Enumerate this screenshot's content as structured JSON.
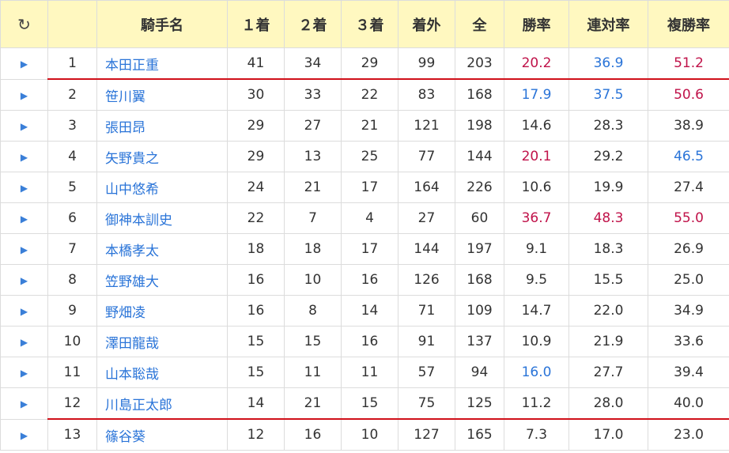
{
  "header": {
    "refresh_icon": "refresh-icon",
    "columns": [
      "騎手名",
      "１着",
      "２着",
      "３着",
      "着外",
      "全",
      "勝率",
      "連対率",
      "複勝率"
    ]
  },
  "colors": {
    "high": "#c0134a",
    "mid": "#2a74d8",
    "separator": "#d0101a",
    "header_bg": "#fff8c0"
  },
  "rows": [
    {
      "rank": "1",
      "name": "本田正重",
      "w1": "41",
      "w2": "34",
      "w3": "29",
      "out": "99",
      "total": "203",
      "win": "20.2",
      "win_c": "red",
      "ren": "36.9",
      "ren_c": "blue",
      "fuku": "51.2",
      "fuku_c": "red",
      "sep": true
    },
    {
      "rank": "2",
      "name": "笹川翼",
      "w1": "30",
      "w2": "33",
      "w3": "22",
      "out": "83",
      "total": "168",
      "win": "17.9",
      "win_c": "blue",
      "ren": "37.5",
      "ren_c": "blue",
      "fuku": "50.6",
      "fuku_c": "red",
      "sep": false
    },
    {
      "rank": "3",
      "name": "張田昂",
      "w1": "29",
      "w2": "27",
      "w3": "21",
      "out": "121",
      "total": "198",
      "win": "14.6",
      "win_c": "",
      "ren": "28.3",
      "ren_c": "",
      "fuku": "38.9",
      "fuku_c": "",
      "sep": false
    },
    {
      "rank": "4",
      "name": "矢野貴之",
      "w1": "29",
      "w2": "13",
      "w3": "25",
      "out": "77",
      "total": "144",
      "win": "20.1",
      "win_c": "red",
      "ren": "29.2",
      "ren_c": "",
      "fuku": "46.5",
      "fuku_c": "blue",
      "sep": false
    },
    {
      "rank": "5",
      "name": "山中悠希",
      "w1": "24",
      "w2": "21",
      "w3": "17",
      "out": "164",
      "total": "226",
      "win": "10.6",
      "win_c": "",
      "ren": "19.9",
      "ren_c": "",
      "fuku": "27.4",
      "fuku_c": "",
      "sep": false
    },
    {
      "rank": "6",
      "name": "御神本訓史",
      "w1": "22",
      "w2": "7",
      "w3": "4",
      "out": "27",
      "total": "60",
      "win": "36.7",
      "win_c": "red",
      "ren": "48.3",
      "ren_c": "red",
      "fuku": "55.0",
      "fuku_c": "red",
      "sep": false
    },
    {
      "rank": "7",
      "name": "本橋孝太",
      "w1": "18",
      "w2": "18",
      "w3": "17",
      "out": "144",
      "total": "197",
      "win": "9.1",
      "win_c": "",
      "ren": "18.3",
      "ren_c": "",
      "fuku": "26.9",
      "fuku_c": "",
      "sep": false
    },
    {
      "rank": "8",
      "name": "笠野雄大",
      "w1": "16",
      "w2": "10",
      "w3": "16",
      "out": "126",
      "total": "168",
      "win": "9.5",
      "win_c": "",
      "ren": "15.5",
      "ren_c": "",
      "fuku": "25.0",
      "fuku_c": "",
      "sep": false
    },
    {
      "rank": "9",
      "name": "野畑凌",
      "w1": "16",
      "w2": "8",
      "w3": "14",
      "out": "71",
      "total": "109",
      "win": "14.7",
      "win_c": "",
      "ren": "22.0",
      "ren_c": "",
      "fuku": "34.9",
      "fuku_c": "",
      "sep": false
    },
    {
      "rank": "10",
      "name": "澤田龍哉",
      "w1": "15",
      "w2": "15",
      "w3": "16",
      "out": "91",
      "total": "137",
      "win": "10.9",
      "win_c": "",
      "ren": "21.9",
      "ren_c": "",
      "fuku": "33.6",
      "fuku_c": "",
      "sep": false
    },
    {
      "rank": "11",
      "name": "山本聡哉",
      "w1": "15",
      "w2": "11",
      "w3": "11",
      "out": "57",
      "total": "94",
      "win": "16.0",
      "win_c": "blue",
      "ren": "27.7",
      "ren_c": "",
      "fuku": "39.4",
      "fuku_c": "",
      "sep": false
    },
    {
      "rank": "12",
      "name": "川島正太郎",
      "w1": "14",
      "w2": "21",
      "w3": "15",
      "out": "75",
      "total": "125",
      "win": "11.2",
      "win_c": "",
      "ren": "28.0",
      "ren_c": "",
      "fuku": "40.0",
      "fuku_c": "",
      "sep": true
    },
    {
      "rank": "13",
      "name": "篠谷葵",
      "w1": "12",
      "w2": "16",
      "w3": "10",
      "out": "127",
      "total": "165",
      "win": "7.3",
      "win_c": "",
      "ren": "17.0",
      "ren_c": "",
      "fuku": "23.0",
      "fuku_c": "",
      "sep": false
    }
  ]
}
